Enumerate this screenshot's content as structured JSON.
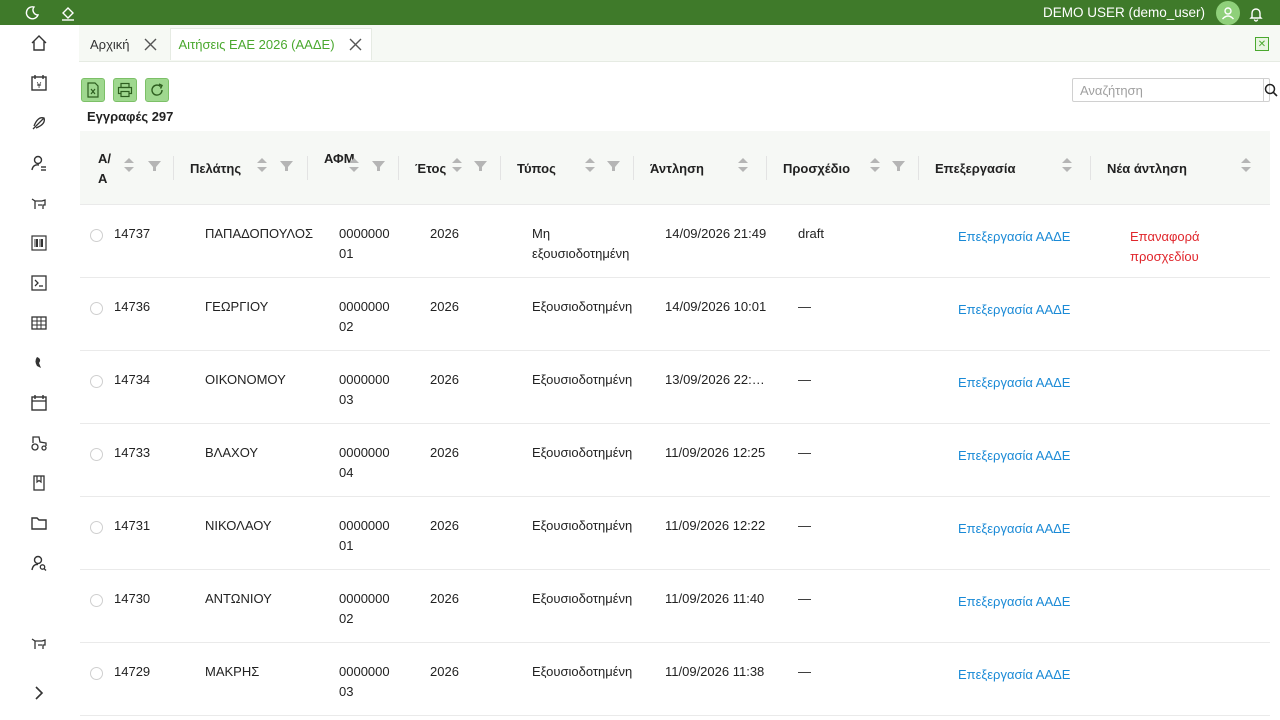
{
  "topbar": {
    "user_label": "DEMO USER (demo_user)",
    "icons": [
      "moon-icon",
      "paint-bucket-icon",
      "user-avatar-icon",
      "bell-icon"
    ],
    "bg_color": "#3f7a2a"
  },
  "sidebar": {
    "icons": [
      "home-icon",
      "calendar-euro-icon",
      "feather-icon",
      "user-settings-icon",
      "cow-icon",
      "barcode-icon",
      "terminal-icon",
      "grid-icon",
      "map-pin-icon",
      "calendar-icon",
      "tractor-icon",
      "book-icon",
      "folder-icon",
      "user-search-icon",
      "cow-icon",
      "chevron-right-icon"
    ]
  },
  "tabs": [
    {
      "label": "Αρχική",
      "active": false
    },
    {
      "label": "Αιτήσεις ΕΑΕ 2026 (ΑΑΔΕ)",
      "active": true
    }
  ],
  "toolbar": {
    "buttons": [
      "excel-export-icon",
      "print-icon",
      "refresh-icon"
    ]
  },
  "records_label": "Εγγραφές 297",
  "search": {
    "placeholder": "Αναζήτηση",
    "value": ""
  },
  "table": {
    "headers": {
      "aa": "Α/Α",
      "client": "Πελάτης",
      "afm": "ΑΦΜ",
      "year": "Έτος",
      "type": "Τύπος",
      "pull": "Άντληση",
      "draft": "Προσχέδιο",
      "process": "Επεξεργασία",
      "newpull": "Νέα άντληση"
    },
    "rows": [
      {
        "id": "14737",
        "client": "ΠΑΠΑΔΟΠΟΥΛΟΣ",
        "afm1": "0000000",
        "afm2": "01",
        "year": "2026",
        "type1": "Μη",
        "type2": "εξουσιοδοτημένη",
        "pull": "14/09/2026 21:49",
        "draft": "draft",
        "process": "Επεξεργασία ΑΑΔΕ",
        "newpull": "Επαναφορά προσχεδίου"
      },
      {
        "id": "14736",
        "client": "ΓΕΩΡΓΙΟΥ",
        "afm1": "0000000",
        "afm2": "02",
        "year": "2026",
        "type1": "Εξουσιοδοτημένη",
        "type2": "",
        "pull": "14/09/2026 10:01",
        "draft": "—",
        "process": "Επεξεργασία ΑΑΔΕ",
        "newpull": ""
      },
      {
        "id": "14734",
        "client": "ΟΙΚΟΝΟΜΟΥ",
        "afm1": "0000000",
        "afm2": "03",
        "year": "2026",
        "type1": "Εξουσιοδοτημένη",
        "type2": "",
        "pull": "13/09/2026 22:…",
        "draft": "—",
        "process": "Επεξεργασία ΑΑΔΕ",
        "newpull": ""
      },
      {
        "id": "14733",
        "client": "ΒΛΑΧΟΥ",
        "afm1": "0000000",
        "afm2": "04",
        "year": "2026",
        "type1": "Εξουσιοδοτημένη",
        "type2": "",
        "pull": "11/09/2026 12:25",
        "draft": "—",
        "process": "Επεξεργασία ΑΑΔΕ",
        "newpull": ""
      },
      {
        "id": "14731",
        "client": "ΝΙΚΟΛΑΟΥ",
        "afm1": "0000000",
        "afm2": "01",
        "year": "2026",
        "type1": "Εξουσιοδοτημένη",
        "type2": "",
        "pull": "11/09/2026 12:22",
        "draft": "—",
        "process": "Επεξεργασία ΑΑΔΕ",
        "newpull": ""
      },
      {
        "id": "14730",
        "client": "ΑΝΤΩΝΙΟΥ",
        "afm1": "0000000",
        "afm2": "02",
        "year": "2026",
        "type1": "Εξουσιοδοτημένη",
        "type2": "",
        "pull": "11/09/2026 11:40",
        "draft": "—",
        "process": "Επεξεργασία ΑΑΔΕ",
        "newpull": ""
      },
      {
        "id": "14729",
        "client": "ΜΑΚΡΗΣ",
        "afm1": "0000000",
        "afm2": "03",
        "year": "2026",
        "type1": "Εξουσιοδοτημένη",
        "type2": "",
        "pull": "11/09/2026 11:38",
        "draft": "—",
        "process": "Επεξεργασία ΑΑΔΕ",
        "newpull": ""
      }
    ]
  },
  "colors": {
    "accent": "#4aa82e",
    "link": "#1a8ad6",
    "danger": "#e0262c"
  }
}
